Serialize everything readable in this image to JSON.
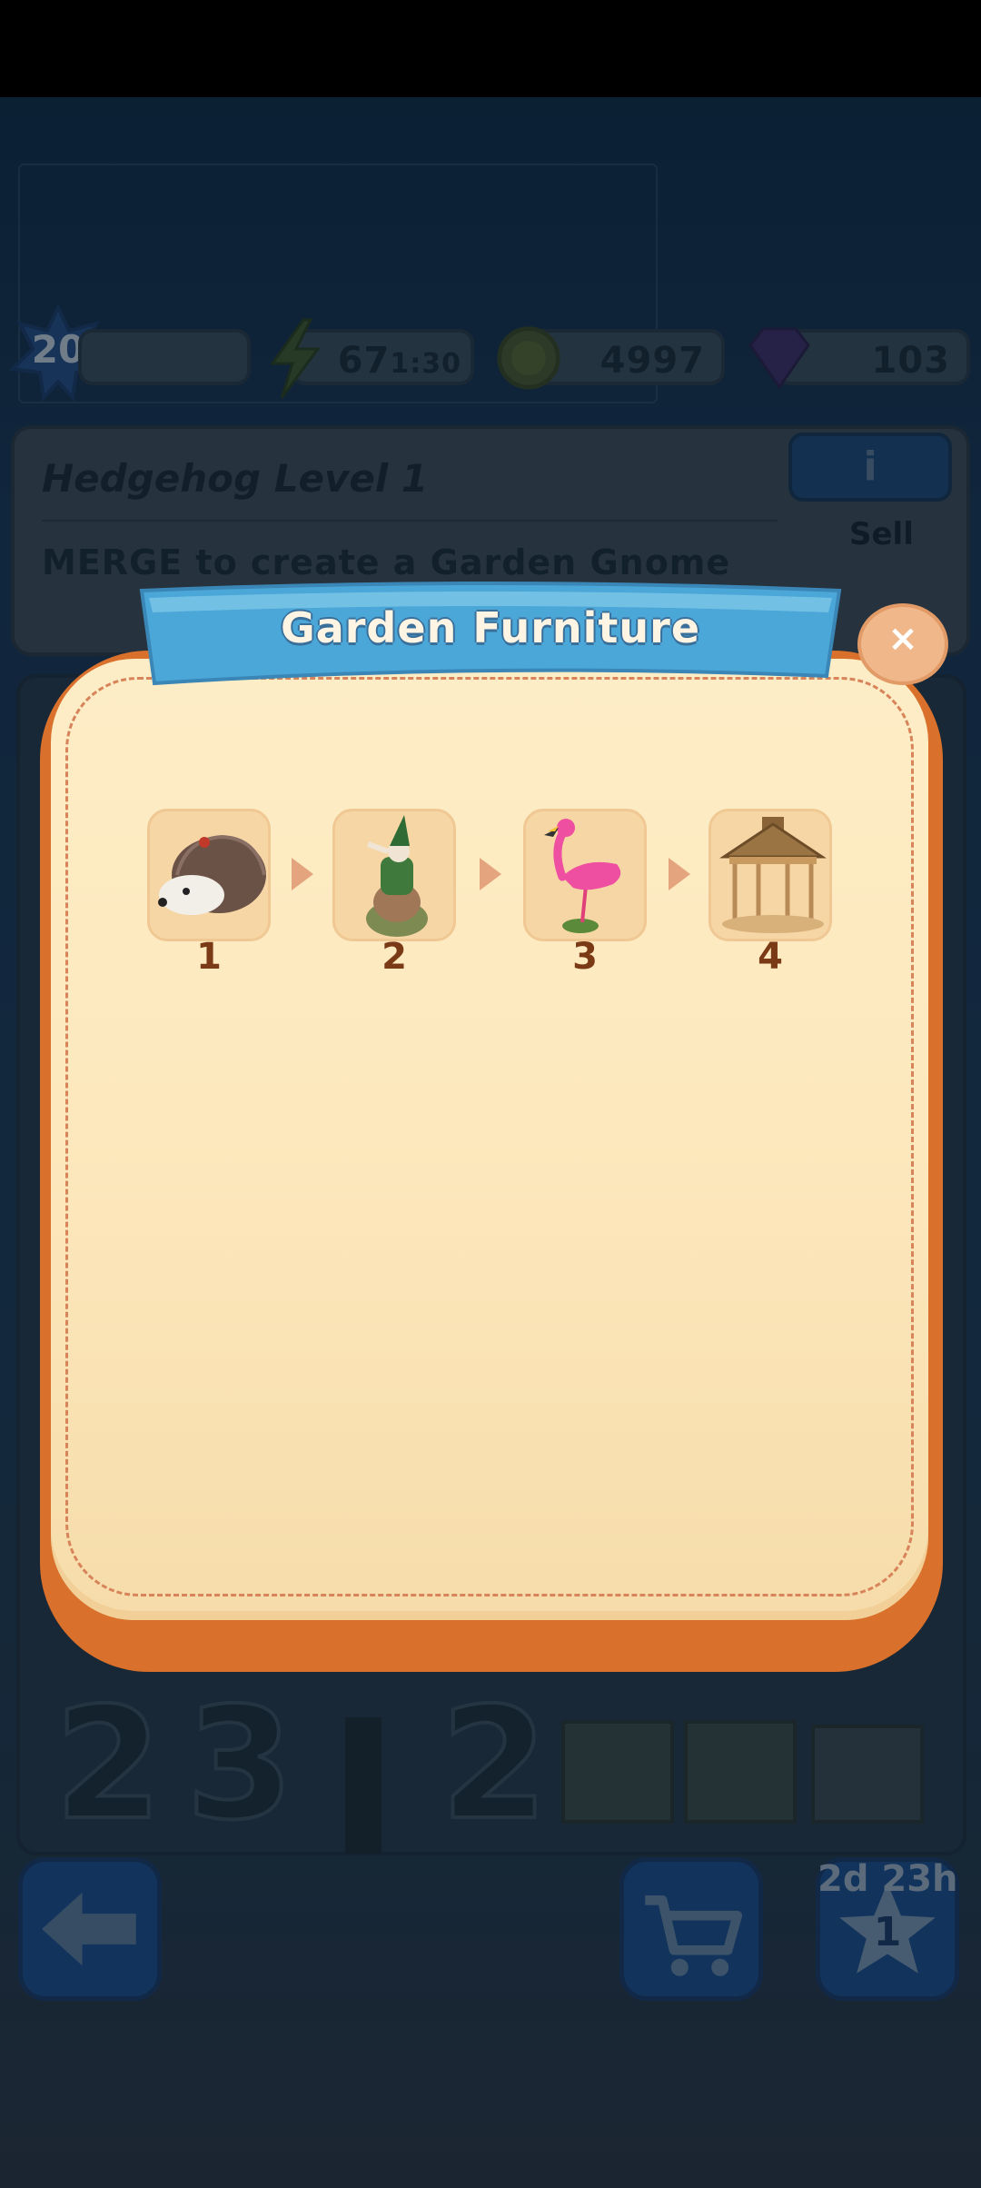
{
  "hud": {
    "level": "20",
    "energy": "67",
    "energy_timer": "1:30",
    "coins": "4997",
    "gems": "103"
  },
  "task": {
    "title": "Hedgehog Level 1",
    "description": "MERGE to create a Garden Gnome",
    "info_label": "i",
    "sell_label": "Sell"
  },
  "footer": {
    "timer": "2d 23h",
    "star_count": "1"
  },
  "modal": {
    "title": "Garden Furniture",
    "close_label": "×",
    "items": [
      {
        "name": "Hedgehog",
        "level": "1"
      },
      {
        "name": "Garden Gnome",
        "level": "2"
      },
      {
        "name": "Flamingo",
        "level": "3"
      },
      {
        "name": "Gazebo",
        "level": "4"
      }
    ]
  },
  "colors": {
    "modal_border": "#e47e2e",
    "modal_fill": "#fde8bd",
    "banner": "#4aa7d8",
    "level_number": "#7a3a15"
  }
}
